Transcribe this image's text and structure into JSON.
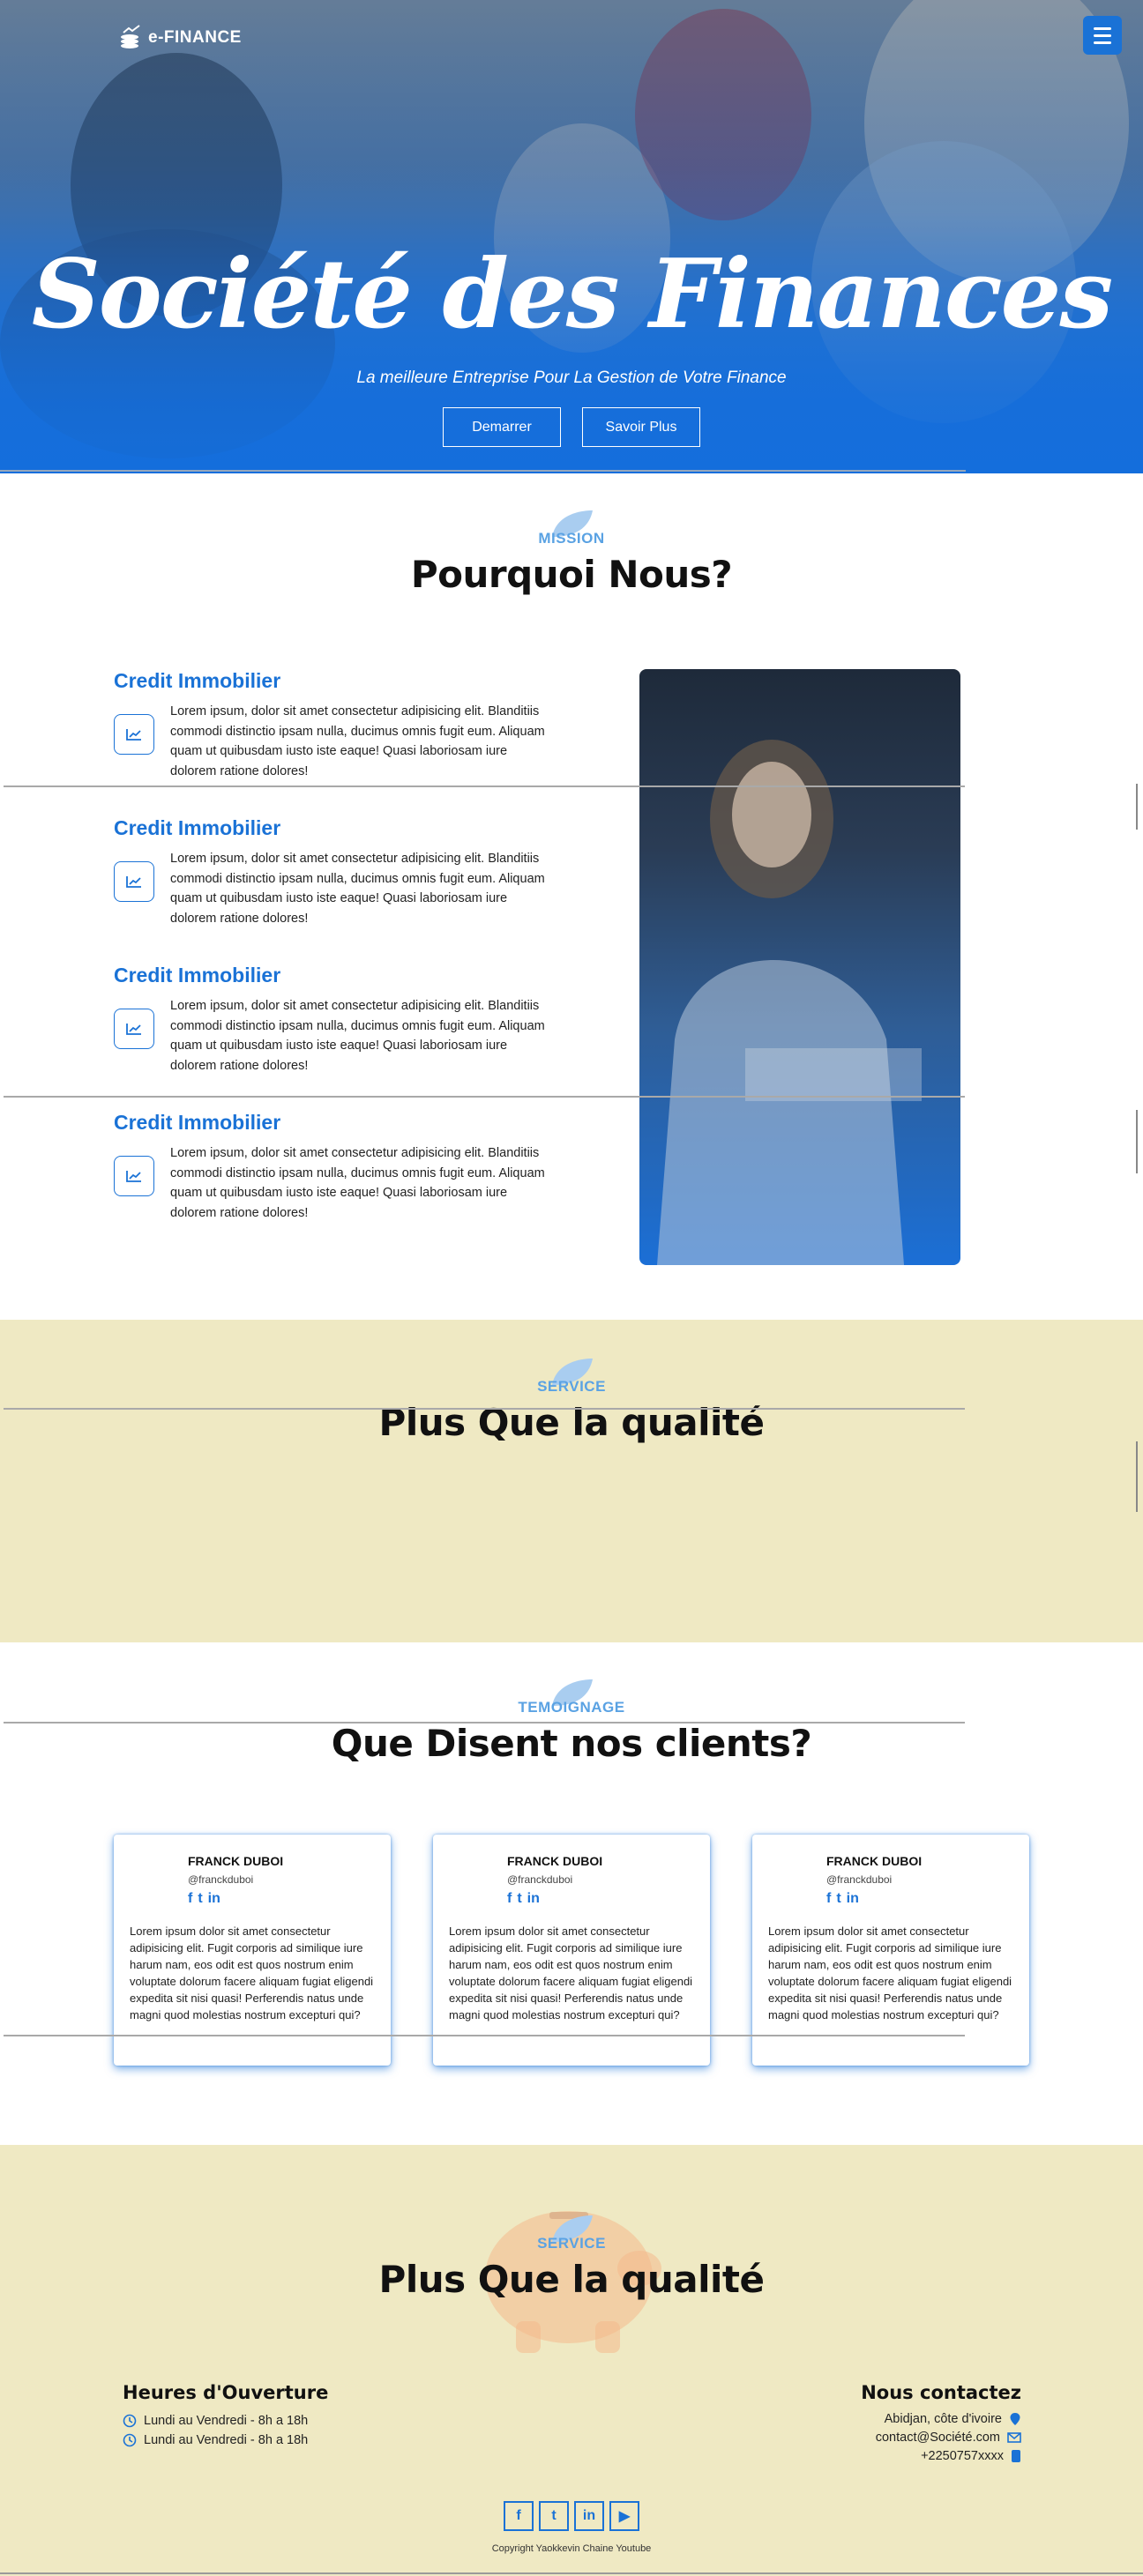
{
  "brand": {
    "logo_text": "e-FINANCE"
  },
  "hero": {
    "title": "Société des Finances",
    "subtitle": "La meilleure Entreprise Pour La Gestion de Votre Finance",
    "buttons": {
      "start": "Demarrer",
      "more": "Savoir Plus"
    }
  },
  "mission": {
    "label": "MISSION",
    "title": "Pourquoi Nous?",
    "features": [
      {
        "title": "Credit Immobilier",
        "text": "Lorem ipsum, dolor sit amet consectetur adipisicing elit. Blanditiis commodi distinctio ipsam nulla, ducimus omnis fugit eum. Aliquam quam ut quibusdam iusto iste eaque! Quasi laboriosam iure dolorem ratione dolores!"
      },
      {
        "title": "Credit Immobilier",
        "text": "Lorem ipsum, dolor sit amet consectetur adipisicing elit. Blanditiis commodi distinctio ipsam nulla, ducimus omnis fugit eum. Aliquam quam ut quibusdam iusto iste eaque! Quasi laboriosam iure dolorem ratione dolores!"
      },
      {
        "title": "Credit Immobilier",
        "text": "Lorem ipsum, dolor sit amet consectetur adipisicing elit. Blanditiis commodi distinctio ipsam nulla, ducimus omnis fugit eum. Aliquam quam ut quibusdam iusto iste eaque! Quasi laboriosam iure dolorem ratione dolores!"
      },
      {
        "title": "Credit Immobilier",
        "text": "Lorem ipsum, dolor sit amet consectetur adipisicing elit. Blanditiis commodi distinctio ipsam nulla, ducimus omnis fugit eum. Aliquam quam ut quibusdam iusto iste eaque! Quasi laboriosam iure dolorem ratione dolores!"
      }
    ]
  },
  "service": {
    "label": "SERVICE",
    "title": "Plus Que la qualité"
  },
  "testimonials": {
    "label": "TEMOIGNAGE",
    "title": "Que Disent nos clients?",
    "social_glyphs": {
      "facebook": "f",
      "twitter": "t",
      "linkedin": "in"
    },
    "cards": [
      {
        "name": "FRANCK DUBOI",
        "handle": "@franckduboi",
        "text": "Lorem ipsum dolor sit amet consectetur adipisicing elit. Fugit corporis ad similique iure harum nam, eos odit est quos nostrum enim voluptate dolorum facere aliquam fugiat eligendi expedita sit nisi quasi! Perferendis natus unde magni quod molestias nostrum excepturi qui?"
      },
      {
        "name": "FRANCK DUBOI",
        "handle": "@franckduboi",
        "text": "Lorem ipsum dolor sit amet consectetur adipisicing elit. Fugit corporis ad similique iure harum nam, eos odit est quos nostrum enim voluptate dolorum facere aliquam fugiat eligendi expedita sit nisi quasi! Perferendis natus unde magni quod molestias nostrum excepturi qui?"
      },
      {
        "name": "FRANCK DUBOI",
        "handle": "@franckduboi",
        "text": "Lorem ipsum dolor sit amet consectetur adipisicing elit. Fugit corporis ad similique iure harum nam, eos odit est quos nostrum enim voluptate dolorum facere aliquam fugiat eligendi expedita sit nisi quasi! Perferendis natus unde magni quod molestias nostrum excepturi qui?"
      }
    ]
  },
  "footer": {
    "label": "SERVICE",
    "title": "Plus Que la qualité",
    "hours": {
      "title": "Heures d'Ouverture",
      "rows": [
        "Lundi au Vendredi - 8h a 18h",
        "Lundi au Vendredi - 8h a 18h"
      ]
    },
    "contact": {
      "title": "Nous contactez",
      "address": "Abidjan, côte d'ivoire",
      "email": "contact@Société.com",
      "phone": "+2250757xxxx"
    },
    "socials": {
      "facebook": "f",
      "twitter": "t",
      "linkedin": "in",
      "youtube": "▶"
    },
    "copyright": "Copyright Yaokkevin Chaine Youtube"
  },
  "colors": {
    "accent": "#1a72d6",
    "label": "#5aa2e3",
    "beige": "#efe9c3"
  },
  "icons": [
    "logo-coins-icon",
    "menu-icon",
    "chart-line-icon",
    "leaf-icon",
    "clock-icon",
    "location-pin-icon",
    "envelope-icon",
    "phone-icon",
    "piggy-bank-icon"
  ]
}
